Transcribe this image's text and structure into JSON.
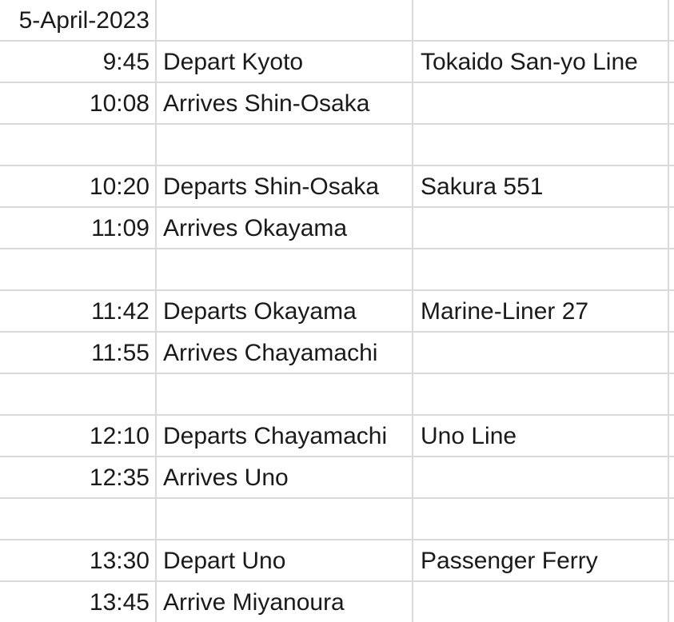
{
  "rows": [
    {
      "time": "5-April-2023",
      "event": "",
      "service": ""
    },
    {
      "time": "9:45",
      "event": "Depart Kyoto",
      "service": "Tokaido San-yo Line"
    },
    {
      "time": "10:08",
      "event": "Arrives Shin-Osaka",
      "service": ""
    },
    {
      "time": "",
      "event": "",
      "service": ""
    },
    {
      "time": "10:20",
      "event": "Departs Shin-Osaka",
      "service": "Sakura 551"
    },
    {
      "time": "11:09",
      "event": "Arrives Okayama",
      "service": ""
    },
    {
      "time": "",
      "event": "",
      "service": ""
    },
    {
      "time": "11:42",
      "event": "Departs Okayama",
      "service": "Marine-Liner 27"
    },
    {
      "time": "11:55",
      "event": "Arrives Chayamachi",
      "service": ""
    },
    {
      "time": "",
      "event": "",
      "service": ""
    },
    {
      "time": "12:10",
      "event": "Departs Chayamachi",
      "service": "Uno Line"
    },
    {
      "time": "12:35",
      "event": "Arrives Uno",
      "service": ""
    },
    {
      "time": "",
      "event": "",
      "service": ""
    },
    {
      "time": "13:30",
      "event": "Depart Uno",
      "service": "Passenger Ferry"
    },
    {
      "time": "13:45",
      "event": "Arrive Miyanoura",
      "service": ""
    }
  ]
}
